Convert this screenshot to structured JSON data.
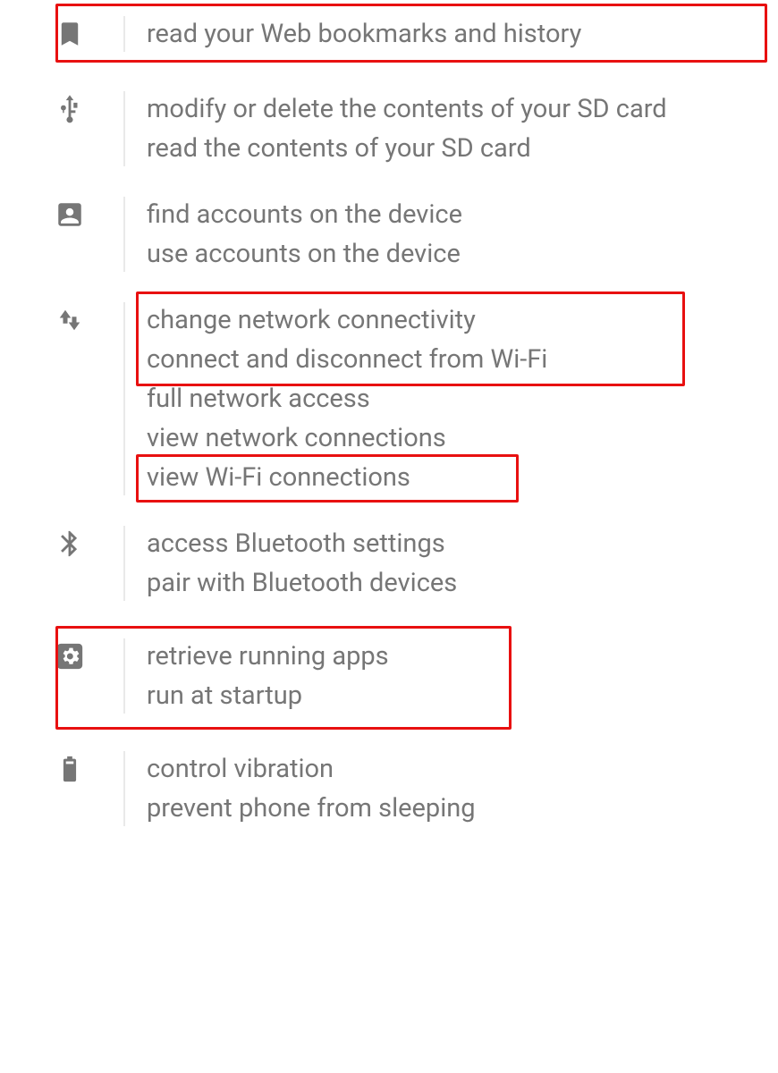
{
  "permissions_list": {
    "groups": [
      {
        "icon": "bookmark",
        "items": [
          {
            "label": "read your Web bookmarks and history"
          }
        ]
      },
      {
        "icon": "usb",
        "items": [
          {
            "label": "modify or delete the contents of your SD card"
          },
          {
            "label": "read the contents of your SD card"
          }
        ]
      },
      {
        "icon": "person-box",
        "items": [
          {
            "label": "find accounts on the device"
          },
          {
            "label": "use accounts on the device"
          }
        ]
      },
      {
        "icon": "network",
        "items": [
          {
            "label": "change network connectivity"
          },
          {
            "label": "connect and disconnect from Wi-Fi"
          },
          {
            "label": "full network access"
          },
          {
            "label": "view network connections"
          },
          {
            "label": "view Wi-Fi connections"
          }
        ]
      },
      {
        "icon": "bluetooth",
        "items": [
          {
            "label": "access Bluetooth settings"
          },
          {
            "label": "pair with Bluetooth devices"
          }
        ]
      },
      {
        "icon": "settings",
        "items": [
          {
            "label": "retrieve running apps"
          },
          {
            "label": "run at startup"
          }
        ]
      },
      {
        "icon": "battery",
        "items": [
          {
            "label": "control vibration"
          },
          {
            "label": "prevent phone from sleeping"
          }
        ]
      }
    ]
  },
  "highlight_boxes": [
    {
      "target": "group-1"
    },
    {
      "target": "network-top"
    },
    {
      "target": "wifi-connections"
    },
    {
      "target": "system-apps"
    }
  ]
}
